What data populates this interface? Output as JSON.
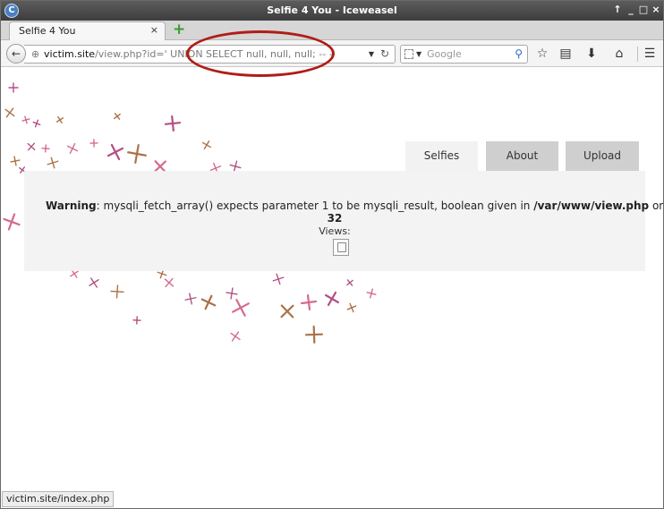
{
  "window": {
    "title": "Selfie 4 You - Iceweasel",
    "app_icon": "C",
    "controls": [
      "↑",
      "_",
      "□",
      "×"
    ]
  },
  "tabbar": {
    "tab_label": "Selfie 4 You",
    "close_glyph": "×",
    "new_tab_glyph": "+"
  },
  "navbar": {
    "back_glyph": "←",
    "url_host": "victim.site",
    "url_path": "/view.php?id=' UNION SELECT null, null, null; -- -",
    "search_placeholder": "Google",
    "icons": [
      "globe-icon",
      "reload-icon",
      "bookmark-star-icon",
      "reading-list-icon",
      "download-icon",
      "home-icon",
      "menu-icon"
    ]
  },
  "site_tabs": {
    "selfies": "Selfies",
    "about": "About",
    "upload": "Upload"
  },
  "content": {
    "warning_label": "Warning",
    "warning_text": ": mysqli_fetch_array() expects parameter 1 to be mysqli_result, boolean given in ",
    "warning_path": "/var/www/view.php",
    "warning_suffix": " on line",
    "line_number": "32",
    "views_label": "Views:"
  },
  "status_bar": {
    "link_text": "victim.site/index.php"
  },
  "colors": {
    "annotation": "#b01d17",
    "deco_purple": "#a8326e",
    "deco_brown": "#9c5a2a",
    "deco_pink": "#d0507e"
  }
}
